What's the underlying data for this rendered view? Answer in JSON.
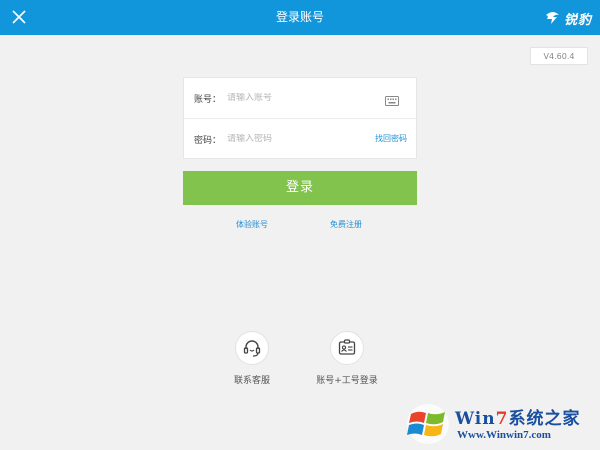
{
  "header": {
    "title": "登录账号",
    "brand": "锐豹",
    "background_color": "#1296db"
  },
  "version": "V4.60.4",
  "form": {
    "account_label": "账号：",
    "account_placeholder": "请输入账号",
    "password_label": "密码：",
    "password_placeholder": "请输入密码",
    "find_password": "找回密码"
  },
  "login_button": {
    "label": "登录",
    "color": "#82c34d"
  },
  "links": {
    "trial_account": "体验账号",
    "free_register": "免费注册"
  },
  "bottom": {
    "customer_service": "联系客服",
    "id_login": "账号+工号登录"
  },
  "watermark": {
    "title_win": "Win",
    "title_seven": "7",
    "title_rest": "系统之家",
    "url": "Www.Winwin7.com"
  },
  "icons": [
    "close-icon",
    "brand-logo-icon",
    "keyboard-icon",
    "headset-icon",
    "id-card-icon",
    "windows-flag-icon"
  ]
}
